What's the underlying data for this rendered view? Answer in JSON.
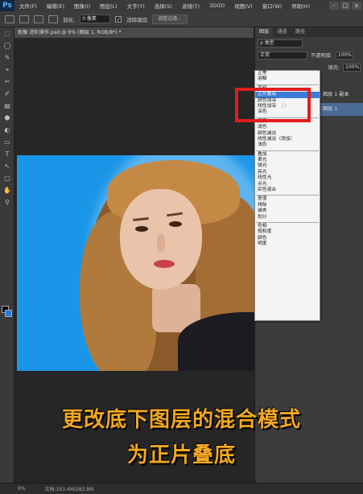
{
  "app": {
    "logo": "Ps"
  },
  "menu": [
    "文件(F)",
    "编辑(E)",
    "图像(I)",
    "图层(L)",
    "文字(Y)",
    "选择(S)",
    "滤镜(T)",
    "3D(D)",
    "视图(V)",
    "窗口(W)",
    "帮助(H)"
  ],
  "window_controls": [
    "-",
    "□",
    "x"
  ],
  "options": {
    "feather_label": "羽化:",
    "feather_value": "0 像素",
    "antialias_label": "消除锯齿",
    "antialias_check": "✓",
    "refine_button": "调整边缘..."
  },
  "document_tab": "抠像 进阶操作.psd @ 9% (图层 1, RGB/8*) *",
  "tools": [
    "⬚",
    "◯",
    "✎",
    "⌖",
    "✂",
    "✐",
    "▤",
    "⬢",
    "◐",
    "▭",
    "T",
    "↖",
    "▢",
    "✋",
    "⚲"
  ],
  "layers_panel": {
    "tabs": [
      "图层",
      "通道",
      "路径"
    ],
    "kind_label": "ρ 类型",
    "blend_mode": "正常",
    "opacity_label": "不透明度:",
    "opacity_value": "100%",
    "fill_label": "填充:",
    "fill_value": "100%",
    "layers": [
      "图层 1 副本",
      "图层 1"
    ]
  },
  "blend_menu": {
    "groups": [
      [
        "正常",
        "溶解"
      ],
      [
        "变暗",
        "正片叠底",
        "颜色加深",
        "线性加深",
        "深色"
      ],
      [
        "变亮",
        "滤色",
        "颜色减淡",
        "线性减淡（添加）",
        "浅色"
      ],
      [
        "叠加",
        "柔光",
        "强光",
        "亮光",
        "线性光",
        "点光",
        "实色混合"
      ],
      [
        "差值",
        "排除",
        "减去",
        "划分"
      ],
      [
        "色相",
        "饱和度",
        "颜色",
        "明度"
      ]
    ],
    "highlighted": "正片叠底"
  },
  "caption": {
    "line1": "更改底下图层的混合模式",
    "line2": "为正片叠底"
  },
  "status": {
    "zoom": "9%",
    "doc_info": "文档:103.4M/282.8M"
  },
  "colors": {
    "highlight_box": "#e01d1d",
    "caption": "#f2a81f",
    "photo_bg": "#1a96e8",
    "menu_highlight": "#3d7cd6"
  }
}
